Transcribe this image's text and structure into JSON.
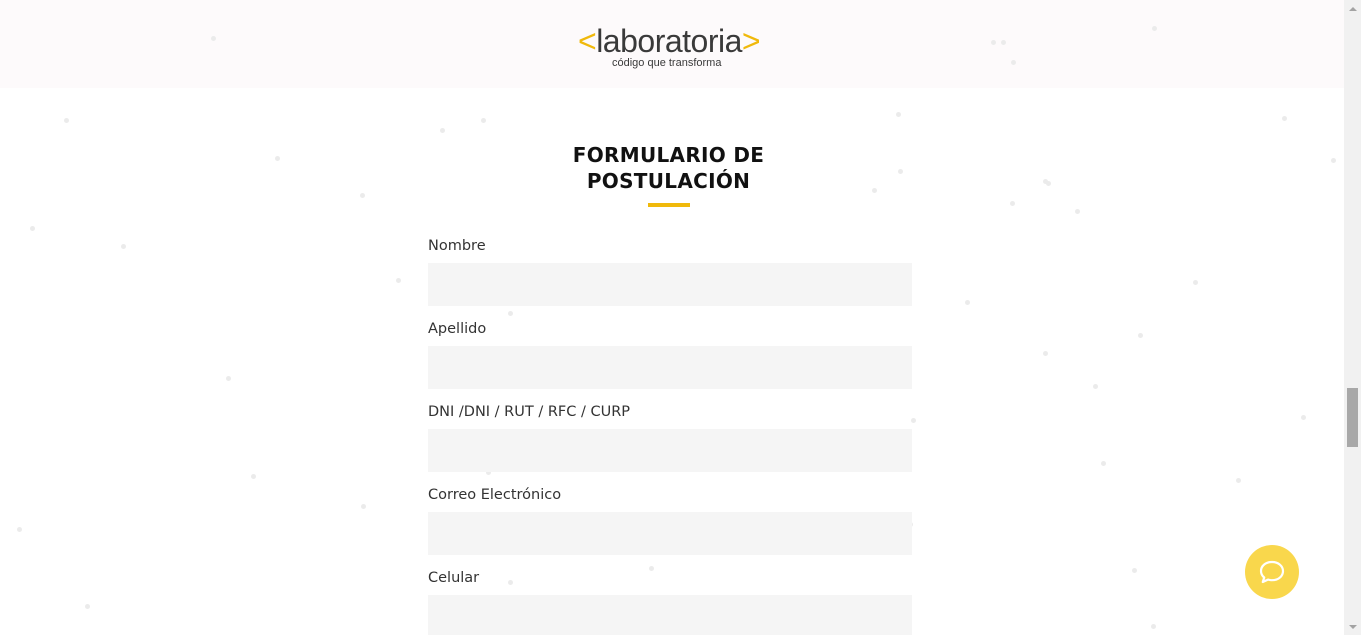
{
  "brand": {
    "bracket_open": "<",
    "name": "laboratoria",
    "bracket_close": ">",
    "tagline": "código que transforma",
    "accent_color": "#f0b90b"
  },
  "form": {
    "title_line1": "FORMULARIO DE",
    "title_line2": "POSTULACIÓN",
    "fields": [
      {
        "label": "Nombre",
        "value": ""
      },
      {
        "label": "Apellido",
        "value": ""
      },
      {
        "label": "DNI /DNI / RUT / RFC / CURP",
        "value": ""
      },
      {
        "label": "Correo Electrónico",
        "value": ""
      },
      {
        "label": "Celular",
        "value": ""
      }
    ]
  },
  "chat": {
    "icon": "chat-bubble-icon",
    "color": "#f9d74c"
  },
  "scrollbar": {
    "arrow_up_icon": "arrow-up-icon",
    "arrow_down_icon": "arrow-down-icon"
  }
}
